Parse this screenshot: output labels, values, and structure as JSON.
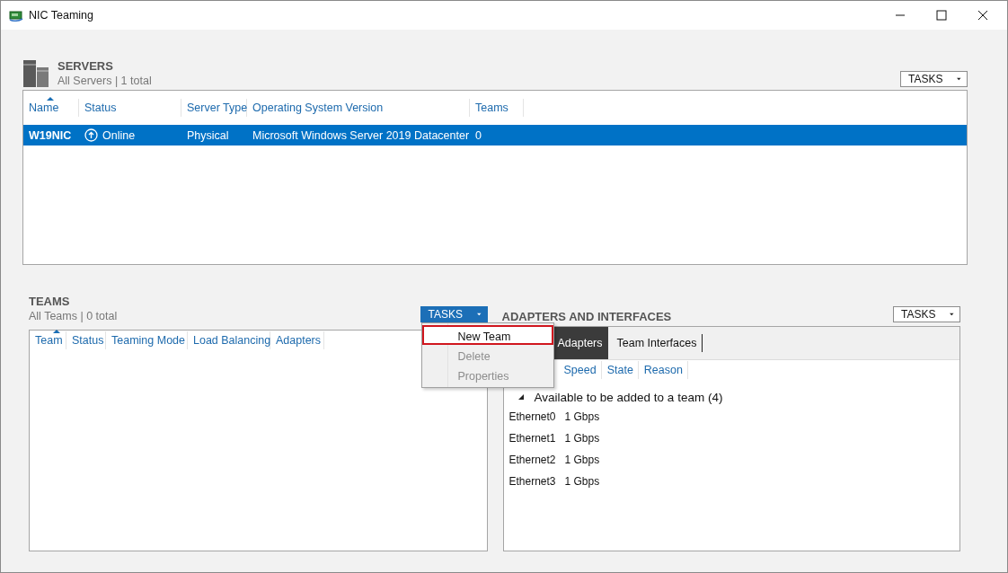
{
  "window": {
    "title": "NIC Teaming"
  },
  "servers": {
    "title": "SERVERS",
    "subtitle": "All Servers | 1 total",
    "tasks": "TASKS",
    "columns": [
      {
        "label": "Name",
        "sorted": true
      },
      {
        "label": "Status",
        "sorted": false
      },
      {
        "label": "Server Type",
        "sorted": false
      },
      {
        "label": "Operating System Version",
        "sorted": false
      },
      {
        "label": "Teams",
        "sorted": false
      }
    ],
    "rows": [
      {
        "selected": true,
        "name": "W19NIC",
        "status": "Online",
        "type": "Physical",
        "os": "Microsoft Windows Server 2019 Datacenter",
        "teams": "0"
      }
    ]
  },
  "teams": {
    "title": "TEAMS",
    "subtitle": "All Teams | 0 total",
    "tasks": "TASKS",
    "tasks_open": true,
    "columns": [
      {
        "label": "Team",
        "sorted": true
      },
      {
        "label": "Status",
        "sorted": false
      },
      {
        "label": "Teaming Mode",
        "sorted": false
      },
      {
        "label": "Load Balancing",
        "sorted": false
      },
      {
        "label": "Adapters",
        "sorted": false
      }
    ]
  },
  "menu": {
    "items": [
      {
        "label": "New Team",
        "selected": true,
        "disabled": false
      },
      {
        "label": "Delete",
        "selected": false,
        "disabled": true
      },
      {
        "label": "Properties",
        "selected": false,
        "disabled": true
      }
    ]
  },
  "adapters": {
    "title": "ADAPTERS AND INTERFACES",
    "tasks": "TASKS",
    "tabs": [
      {
        "label": "Adapters",
        "selected": true
      },
      {
        "label": "Team Interfaces",
        "selected": false
      }
    ],
    "columns": [
      "Speed",
      "State",
      "Reason"
    ],
    "groups": [
      {
        "label": "Available to be added to a team (4)",
        "expanded": true,
        "items": [
          {
            "name": "Ethernet0",
            "speed": "1 Gbps"
          },
          {
            "name": "Ethernet1",
            "speed": "1 Gbps"
          },
          {
            "name": "Ethernet2",
            "speed": "1 Gbps"
          },
          {
            "name": "Ethernet3",
            "speed": "1 Gbps"
          }
        ]
      }
    ]
  }
}
